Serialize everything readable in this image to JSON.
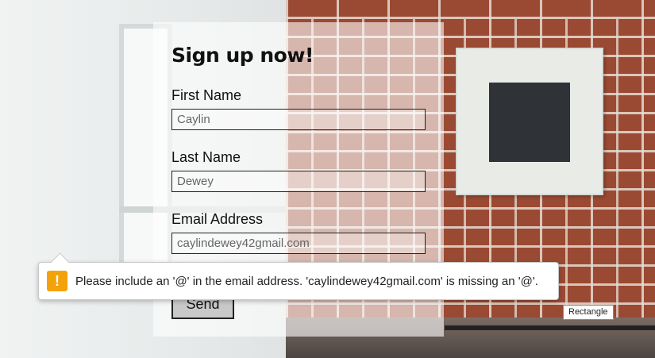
{
  "form": {
    "title": "Sign up now!",
    "first_name_label": "First Name",
    "first_name_value": "Caylin",
    "last_name_label": "Last Name",
    "last_name_value": "Dewey",
    "email_label": "Email Address",
    "email_value": "caylindewey42gmail.com",
    "send_label": "Send"
  },
  "validation_tooltip": {
    "icon": "warning-icon",
    "icon_glyph": "!",
    "message": "Please include an '@' in the email address. 'caylindewey42gmail.com' is missing an '@'."
  },
  "hover_tooltip": {
    "text": "Rectangle"
  },
  "colors": {
    "warning": "#f4a20b",
    "panel": "rgba(255,255,255,0.60)"
  }
}
